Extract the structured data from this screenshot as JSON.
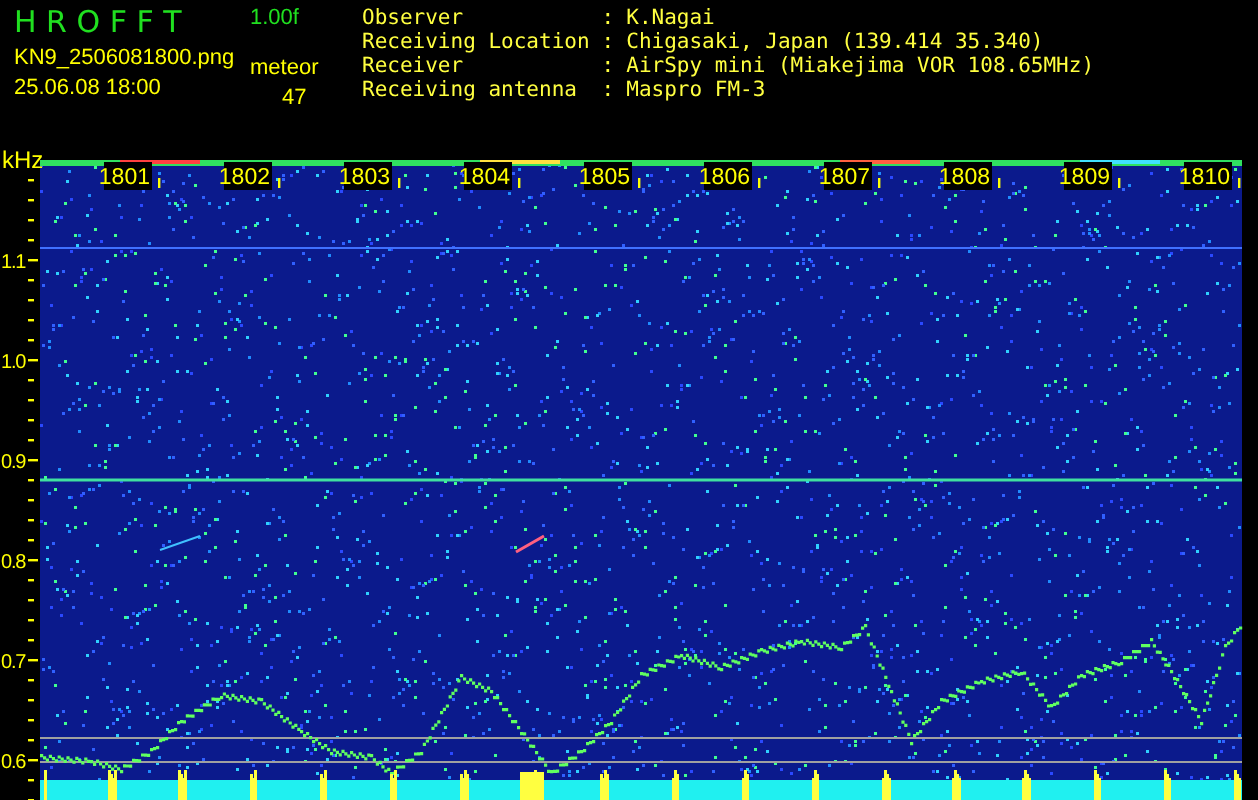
{
  "header": {
    "title": "H R O F F T",
    "version": "1.00f",
    "file_name": "KN9_2506081800.png",
    "date_time": "25.06.08 18:00",
    "count_label": "meteor",
    "count": "47"
  },
  "info": [
    {
      "label": "Observer",
      "separator": ":",
      "value": "K.Nagai"
    },
    {
      "label": "Receiving Location",
      "separator": ":",
      "value": "Chigasaki, Japan (139.414 35.340)"
    },
    {
      "label": "Receiver",
      "separator": ":",
      "value": "AirSpy mini (Miakejima VOR 108.65MHz)"
    },
    {
      "label": "Receiving antenna",
      "separator": ":",
      "value": "Maspro FM-3"
    }
  ],
  "spectrogram": {
    "unit": "kHz",
    "y_labels": [
      "1.1",
      "1.0",
      "0.9",
      "0.8",
      "0.7",
      "0.6"
    ],
    "time_labels": [
      "1801",
      "1802",
      "1803",
      "1804",
      "1805",
      "1806",
      "1807",
      "1808",
      "1809",
      "1810"
    ]
  }
}
